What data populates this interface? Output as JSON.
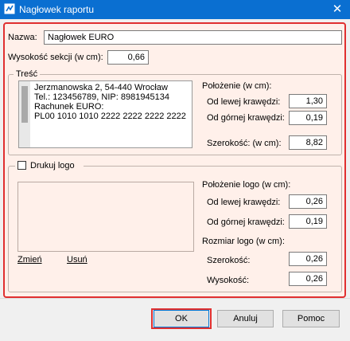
{
  "window": {
    "title": "Nagłowek raportu",
    "close_symbol": "✕"
  },
  "name_label": "Nazwa:",
  "name_value": "Nagłowek EURO",
  "section_height_label": "Wysokość sekcji (w cm):",
  "section_height_value": "0,66",
  "content": {
    "legend": "Treść",
    "text_lines": [
      "Jerzmanowska 2, 54-440 Wrocław",
      "Tel.: 123456789, NIP: 8981945134",
      "Rachunek EURO:",
      "PL00 1010 1010 2222 2222 2222 2222"
    ],
    "position_label": "Położenie (w cm):",
    "left_label": "Od lewej krawędzi:",
    "left_value": "1,30",
    "top_label": "Od górnej krawędzi:",
    "top_value": "0,19",
    "width_label": "Szerokość: (w cm):",
    "width_value": "8,82"
  },
  "logo": {
    "checkbox_label": "Drukuj logo",
    "change_link": "Zmień",
    "delete_link": "Usuń",
    "position_label": "Położenie logo (w cm):",
    "left_label": "Od lewej krawędzi:",
    "left_value": "0,26",
    "top_label": "Od górnej krawędzi:",
    "top_value": "0,19",
    "size_label": "Rozmiar logo (w cm):",
    "width_label": "Szerokość:",
    "width_value": "0,26",
    "height_label": "Wysokość:",
    "height_value": "0,26"
  },
  "buttons": {
    "ok": "OK",
    "cancel": "Anuluj",
    "help": "Pomoc"
  }
}
